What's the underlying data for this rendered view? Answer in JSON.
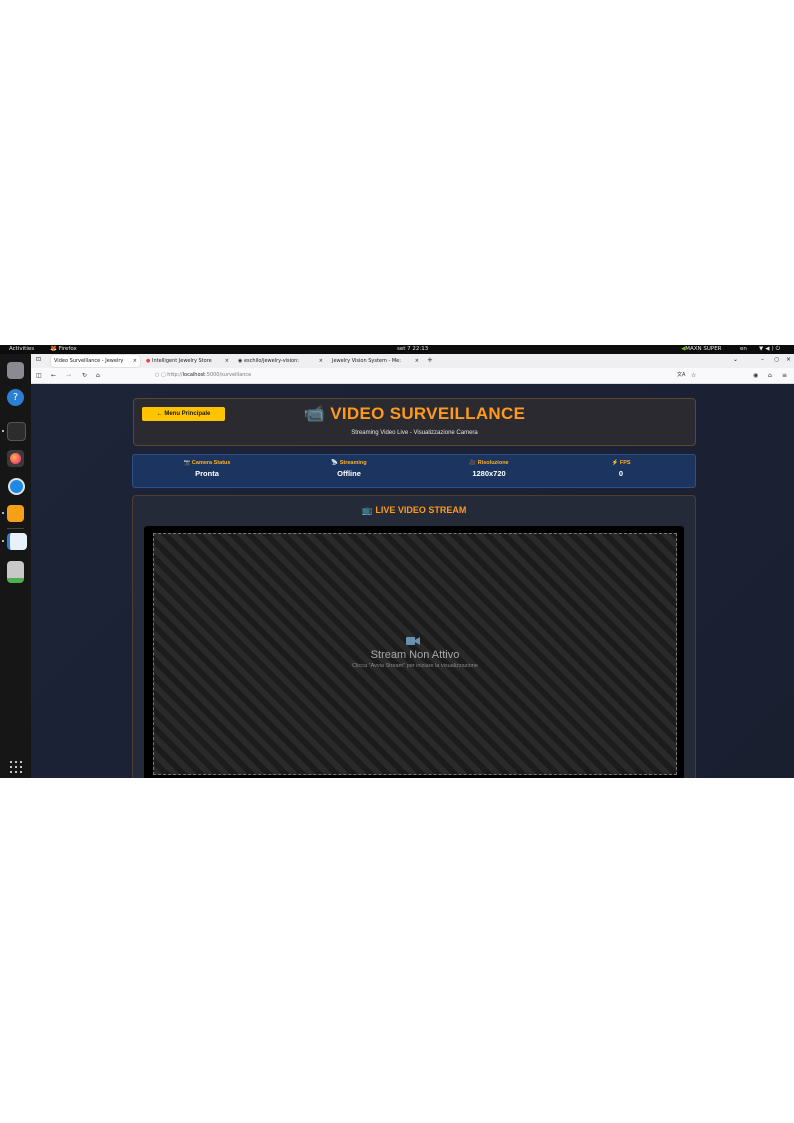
{
  "system": {
    "activities": "Activities",
    "app_name": "Firefox",
    "clock": "set 7  22:13",
    "gpu_label": "MAXN SUPER",
    "language": "en"
  },
  "browser": {
    "tabs": [
      {
        "label": "Video Surveillance - Jewelry"
      },
      {
        "label": "Intelligent Jewelry Store"
      },
      {
        "label": "eschilo/jewelry-vision:"
      },
      {
        "label": "Jewelry Vision System - Me:"
      }
    ],
    "url_prefix": "http://",
    "url_host": "localhost",
    "url_path": ":5000/surveillance"
  },
  "page": {
    "back_button": "← Menu Principale",
    "title": "VIDEO SURVEILLANCE",
    "subtitle": "Streaming Video Live - Visualizzazione Camera",
    "stats": [
      {
        "label": "📷 Camera Status",
        "value": "Pronta"
      },
      {
        "label": "📡 Streaming",
        "value": "Offline"
      },
      {
        "label": "🎥 Risoluzione",
        "value": "1280x720"
      },
      {
        "label": "⚡ FPS",
        "value": "0"
      }
    ],
    "stream_title": "📺 LIVE VIDEO STREAM",
    "placeholder_title": "Stream Non Attivo",
    "placeholder_hint": "Clicca \"Avvia Stream\" per iniziare la visualizzazione"
  },
  "colors": {
    "accent": "#ff9a1f",
    "button": "#ffc400",
    "status_bg": "#1c3560",
    "page_bg": "#1b2030"
  }
}
